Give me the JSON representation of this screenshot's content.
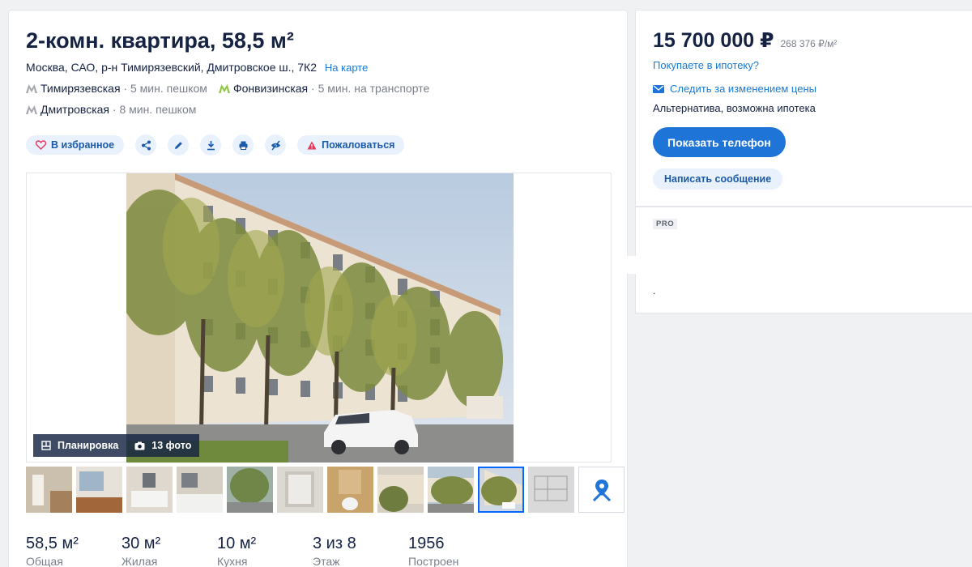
{
  "listing": {
    "title": "2-комн. квартира, 58,5 м²",
    "address": "Москва, САО, р-н Тимирязевский, Дмитровское ш., 7К2",
    "map_link": "На карте",
    "metro": [
      {
        "name": "Тимирязевская",
        "time": "5 мин. пешком",
        "color": "#a5a8ad"
      },
      {
        "name": "Фонвизинская",
        "time": "5 мин. на транспорте",
        "color": "#8dc63f"
      },
      {
        "name": "Дмитровская",
        "time": "8 мин. пешком",
        "color": "#a5a8ad"
      }
    ]
  },
  "actions": {
    "favorite": "В избранное",
    "share_icon": "share-icon",
    "edit_icon": "pencil-icon",
    "download_icon": "download-icon",
    "print_icon": "print-icon",
    "hide_icon": "eye-off-icon",
    "complain": "Пожаловаться"
  },
  "gallery": {
    "layout_label": "Планировка",
    "photos_label": "13 фото",
    "thumbnail_count": 10,
    "active_thumbnail": 9
  },
  "facts": [
    {
      "value": "58,5 м²",
      "label": "Общая"
    },
    {
      "value": "30 м²",
      "label": "Жилая"
    },
    {
      "value": "10 м²",
      "label": "Кухня"
    },
    {
      "value": "3 из 8",
      "label": "Этаж"
    },
    {
      "value": "1956",
      "label": "Построен"
    }
  ],
  "sidebar": {
    "price": "15 700 000 ₽",
    "price_per_sqm": "268 376 ₽/м²",
    "mortgage_link": "Покупаете в ипотеку?",
    "follow_price": "Следить за изменением цены",
    "deal_type": "Альтернатива, возможна ипотека",
    "show_phone": "Показать телефон",
    "write_message": "Написать сообщение"
  },
  "agent": {
    "badge": "PRO",
    "dot": "."
  },
  "colors": {
    "accent": "#1f74d8",
    "link": "#1a7bd6",
    "text": "#152242",
    "muted": "#7a7f8a"
  }
}
